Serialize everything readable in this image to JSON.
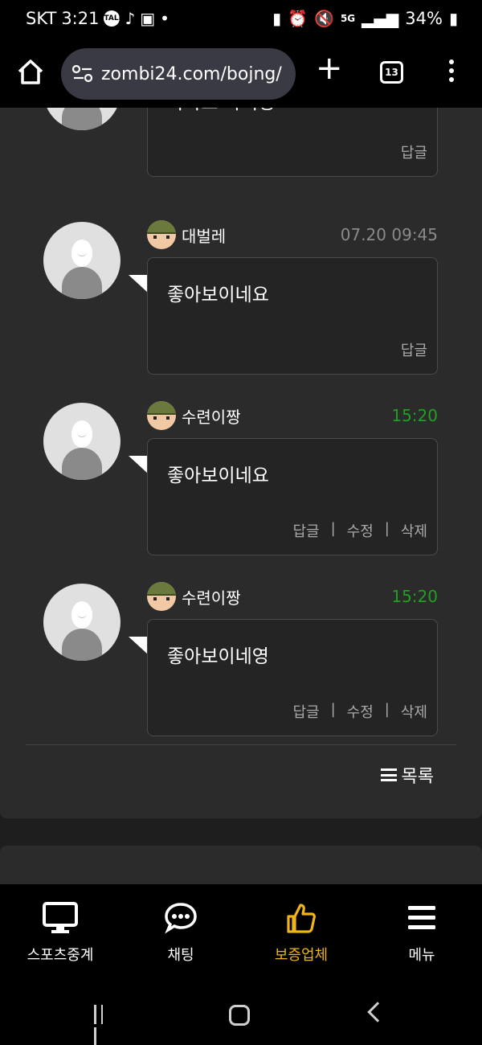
{
  "status_bar": {
    "carrier": "SKT",
    "time": "3:21",
    "talk_label": "TALK",
    "network": "5G",
    "battery": "34%"
  },
  "browser": {
    "url": "zombi24.com/bojng/",
    "tab_count": "13"
  },
  "comments": {
    "partial": {
      "text": "바카오 와이팅",
      "reply": "답글"
    },
    "items": [
      {
        "nickname": "대벌레",
        "time": "07.20 09:45",
        "time_color": "#8a8a8a",
        "text": "좋아보이네요",
        "reply": "답글"
      },
      {
        "nickname": "수련이짱",
        "time": "15:20",
        "time_color": "#20a020",
        "text": "좋아보이네요",
        "reply": "답글",
        "edit": "수정",
        "delete": "삭제"
      },
      {
        "nickname": "수련이짱",
        "time": "15:20",
        "time_color": "#20a020",
        "text": "좋아보이네영",
        "reply": "답글",
        "edit": "수정",
        "delete": "삭제"
      }
    ],
    "separator": "|"
  },
  "list_button": "목록",
  "bottom_nav": {
    "sports": "스포츠중계",
    "chat": "채팅",
    "guarantee": "보증업체",
    "menu": "메뉴",
    "active_color": "#f0b419"
  }
}
